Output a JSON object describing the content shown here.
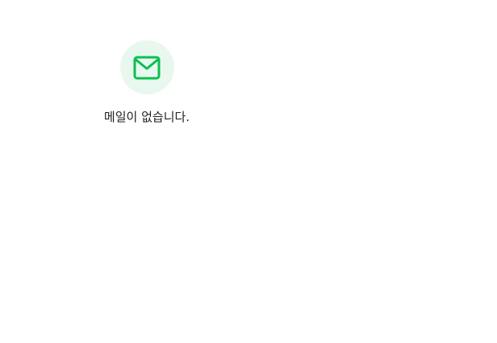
{
  "empty_state": {
    "icon": "mail-icon",
    "message": "메일이 없습니다.",
    "icon_color": "#0bbf4f",
    "icon_bg_color": "#e8f8ee"
  }
}
